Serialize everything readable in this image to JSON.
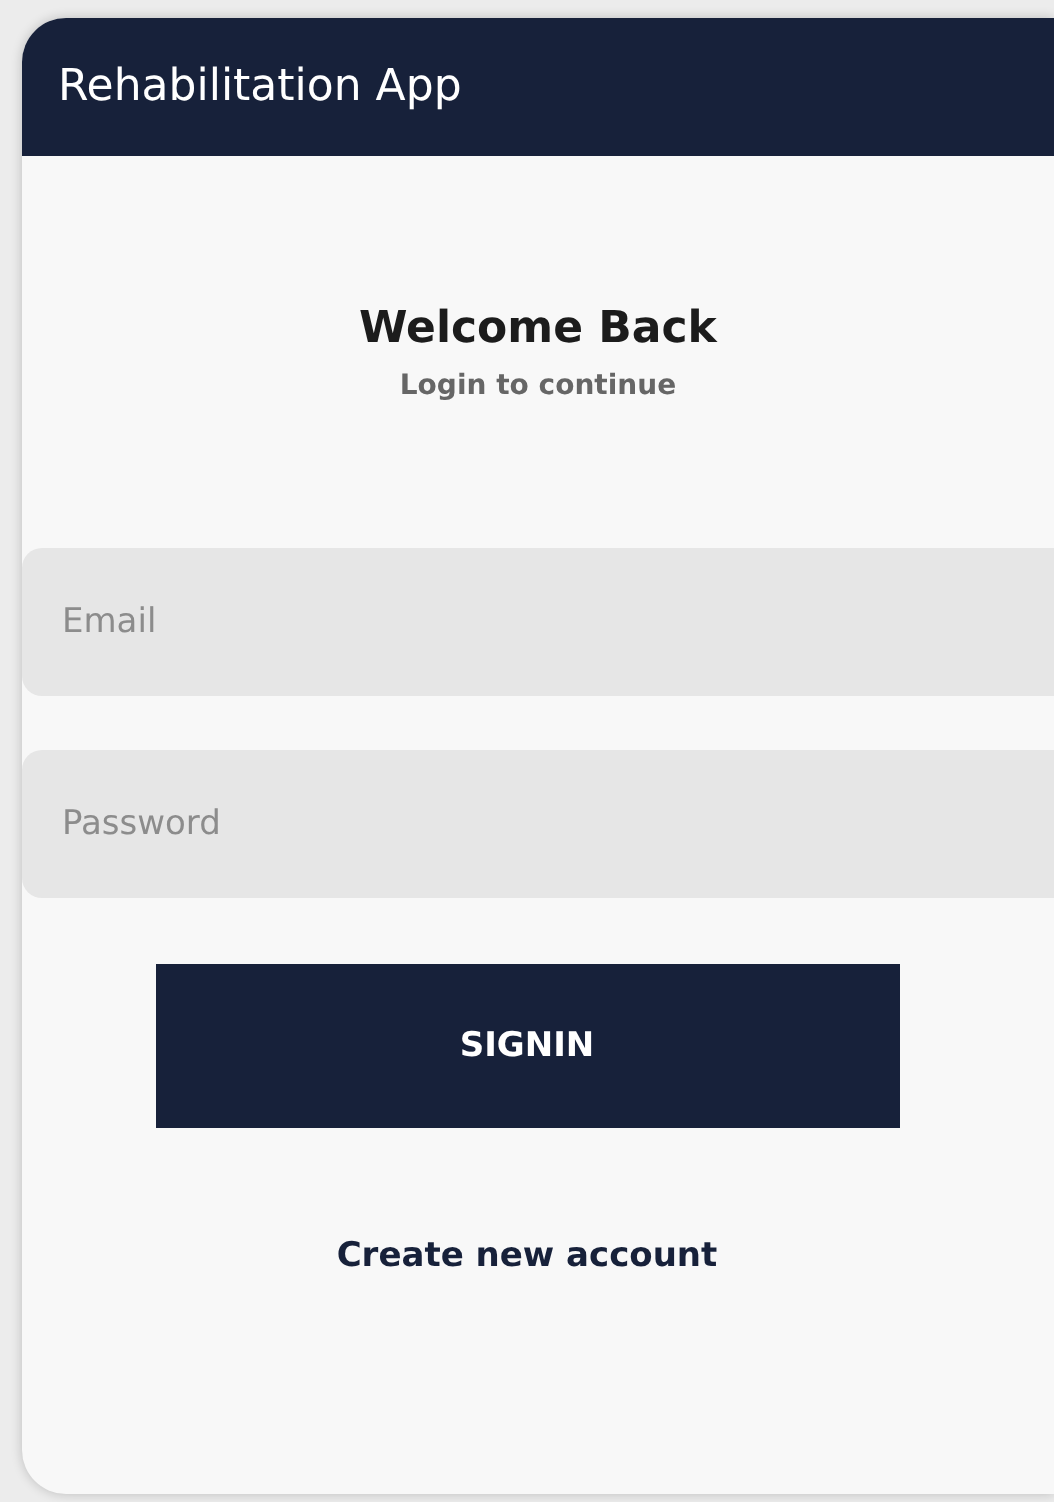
{
  "app_bar": {
    "title": "Rehabilitation App"
  },
  "heading": {
    "title": "Welcome Back",
    "subtitle": "Login to continue"
  },
  "fields": [
    {
      "placeholder": "Email"
    },
    {
      "placeholder": "Password"
    }
  ],
  "submit_button": "SIGNIN",
  "link": "Create new account"
}
